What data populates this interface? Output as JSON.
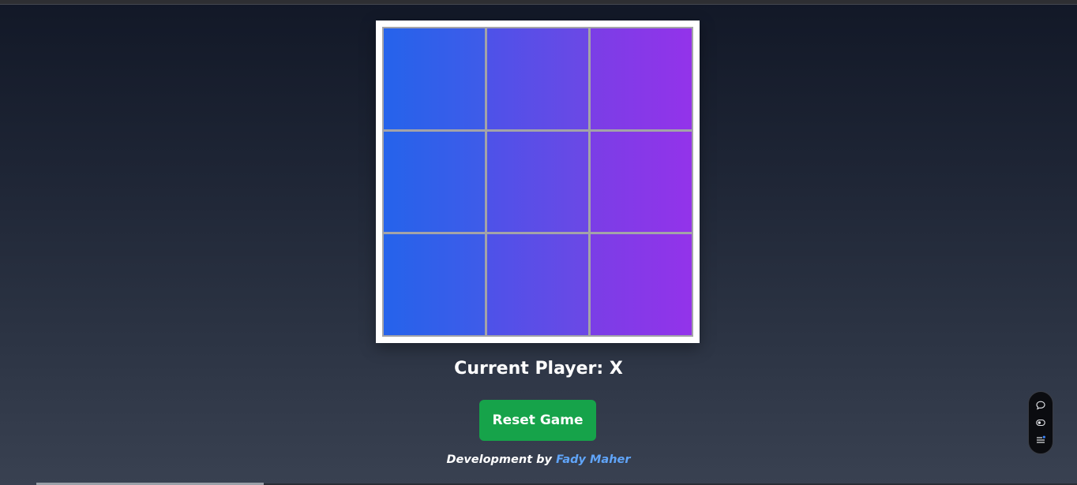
{
  "game": {
    "board": [
      [
        "",
        "",
        ""
      ],
      [
        "",
        "",
        ""
      ],
      [
        "",
        "",
        ""
      ]
    ],
    "status_text": "Current Player: X",
    "current_player": "X"
  },
  "controls": {
    "reset_label": "Reset Game"
  },
  "footer": {
    "prefix": "Development by",
    "author": "Fady Maher"
  },
  "floating_toolbar": {
    "icons": [
      "chat-bubble-icon",
      "toggle-icon",
      "list-settings-icon"
    ]
  },
  "colors": {
    "cell_gradient_start": "#2563eb",
    "cell_gradient_end": "#9333ea",
    "reset_button": "#16a34a",
    "author_link": "#60a5fa",
    "grid_lines": "#a3a3a8"
  }
}
